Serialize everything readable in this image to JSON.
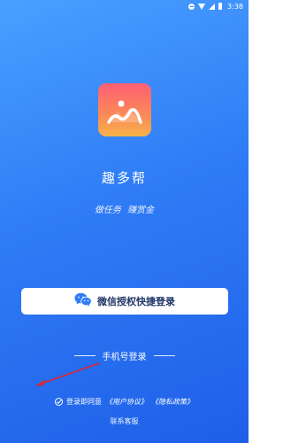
{
  "status_bar": {
    "time": "3:38",
    "icons": [
      "dnd-icon",
      "wifi-icon",
      "signal-icon",
      "battery-icon"
    ]
  },
  "app": {
    "logo_icon": "app-logo-icon",
    "name": "趣多帮",
    "slogan": "做任务 赚赏金"
  },
  "wechat_login": {
    "icon": "wechat-icon",
    "label": "微信授权快捷登录",
    "icon_color": "#2f7cf6"
  },
  "phone_login": {
    "label": "手机号登录"
  },
  "agreement": {
    "prefix": "登录即同意",
    "user_agreement": "《用户协议》",
    "privacy_policy": "《隐私政策》"
  },
  "contact": {
    "label": "联系客服"
  },
  "colors": {
    "background_start": "#4aa0ff",
    "background_end": "#1f5fe8",
    "logo_top": "#fd5f73",
    "logo_bottom": "#f6b24a",
    "arrow": "#e0242c"
  }
}
